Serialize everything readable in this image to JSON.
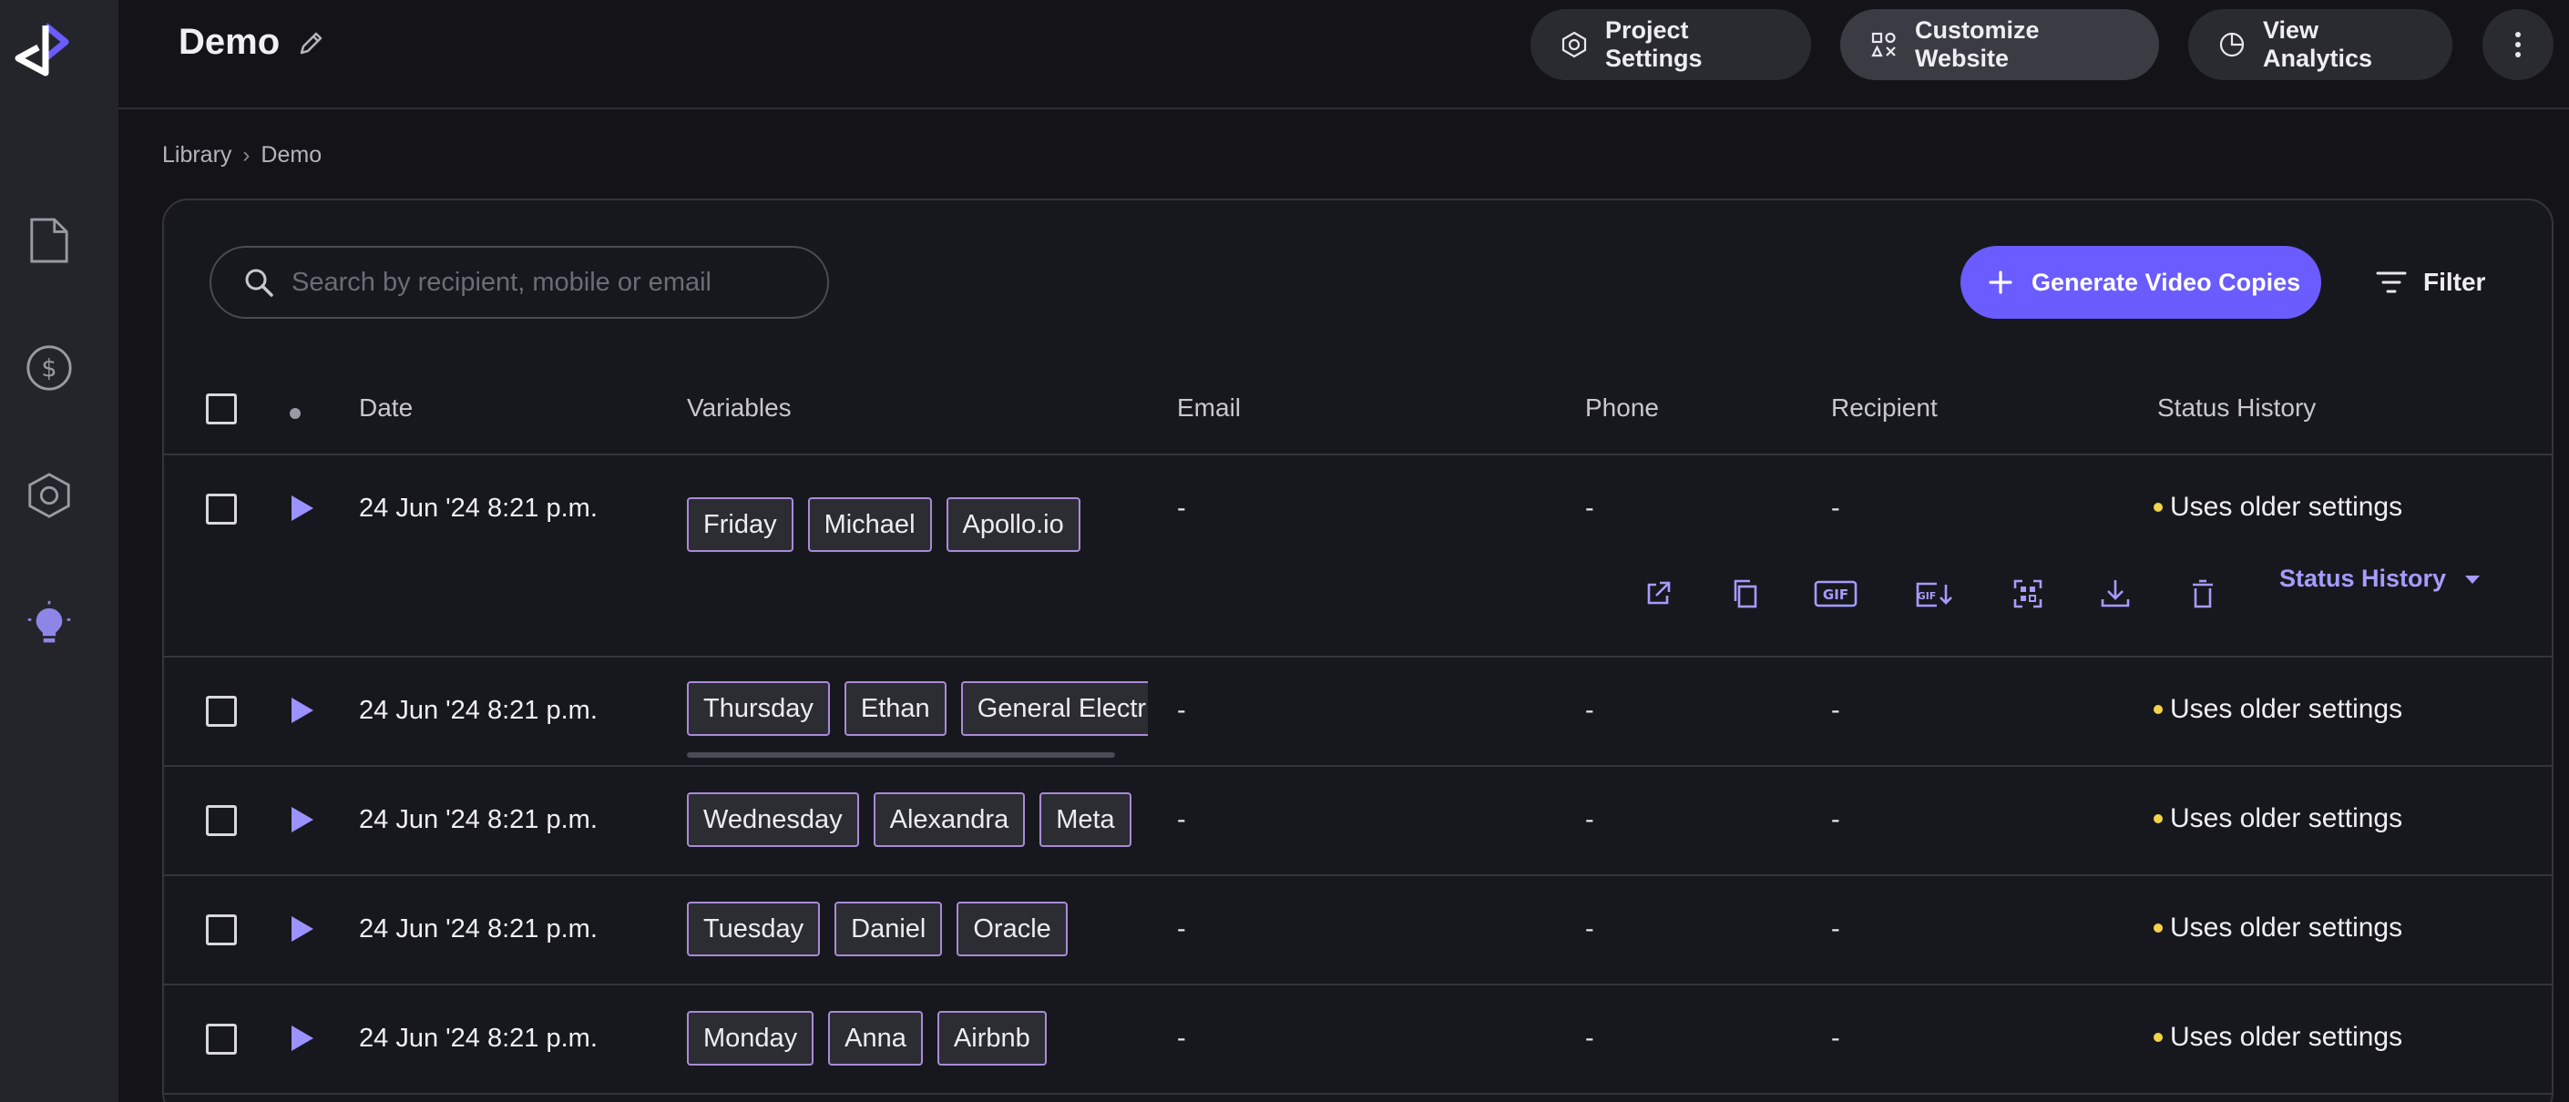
{
  "header": {
    "title": "Demo",
    "buttons": {
      "project_settings": "Project Settings",
      "customize_website": "Customize Website",
      "view_analytics": "View Analytics"
    }
  },
  "breadcrumb": {
    "items": [
      "Library",
      "Demo"
    ]
  },
  "search": {
    "placeholder": "Search by recipient, mobile or email"
  },
  "toolbar": {
    "generate_label": "Generate Video Copies",
    "filter_label": "Filter"
  },
  "table": {
    "columns": [
      "Date",
      "Variables",
      "Email",
      "Phone",
      "Recipient",
      "Status History"
    ],
    "rows": [
      {
        "date": "24 Jun '24 8:21 p.m.",
        "variables": [
          "Friday",
          "Michael",
          "Apollo.io"
        ],
        "email": "-",
        "phone": "-",
        "recipient": "-",
        "status": "Uses older settings"
      },
      {
        "date": "24 Jun '24 8:21 p.m.",
        "variables": [
          "Thursday",
          "Ethan",
          "General Electr"
        ],
        "email": "-",
        "phone": "-",
        "recipient": "-",
        "status": "Uses older settings"
      },
      {
        "date": "24 Jun '24 8:21 p.m.",
        "variables": [
          "Wednesday",
          "Alexandra",
          "Meta"
        ],
        "email": "-",
        "phone": "-",
        "recipient": "-",
        "status": "Uses older settings"
      },
      {
        "date": "24 Jun '24 8:21 p.m.",
        "variables": [
          "Tuesday",
          "Daniel",
          "Oracle"
        ],
        "email": "-",
        "phone": "-",
        "recipient": "-",
        "status": "Uses older settings"
      },
      {
        "date": "24 Jun '24 8:21 p.m.",
        "variables": [
          "Monday",
          "Anna",
          "Airbnb"
        ],
        "email": "-",
        "phone": "-",
        "recipient": "-",
        "status": "Uses older settings"
      }
    ],
    "expanded_row_actions": {
      "status_history_label": "Status History",
      "icons": [
        "open-external-icon",
        "copy-icon",
        "gif-icon",
        "gif-download-icon",
        "qr-code-icon",
        "download-icon",
        "delete-icon"
      ]
    }
  },
  "colors": {
    "accent": "#6a5cff",
    "accent_text": "#a59cff",
    "tag_border": "#a98ad6",
    "status_dot": "#f3d34a",
    "background": "#141418",
    "sidebar": "#24252b"
  }
}
